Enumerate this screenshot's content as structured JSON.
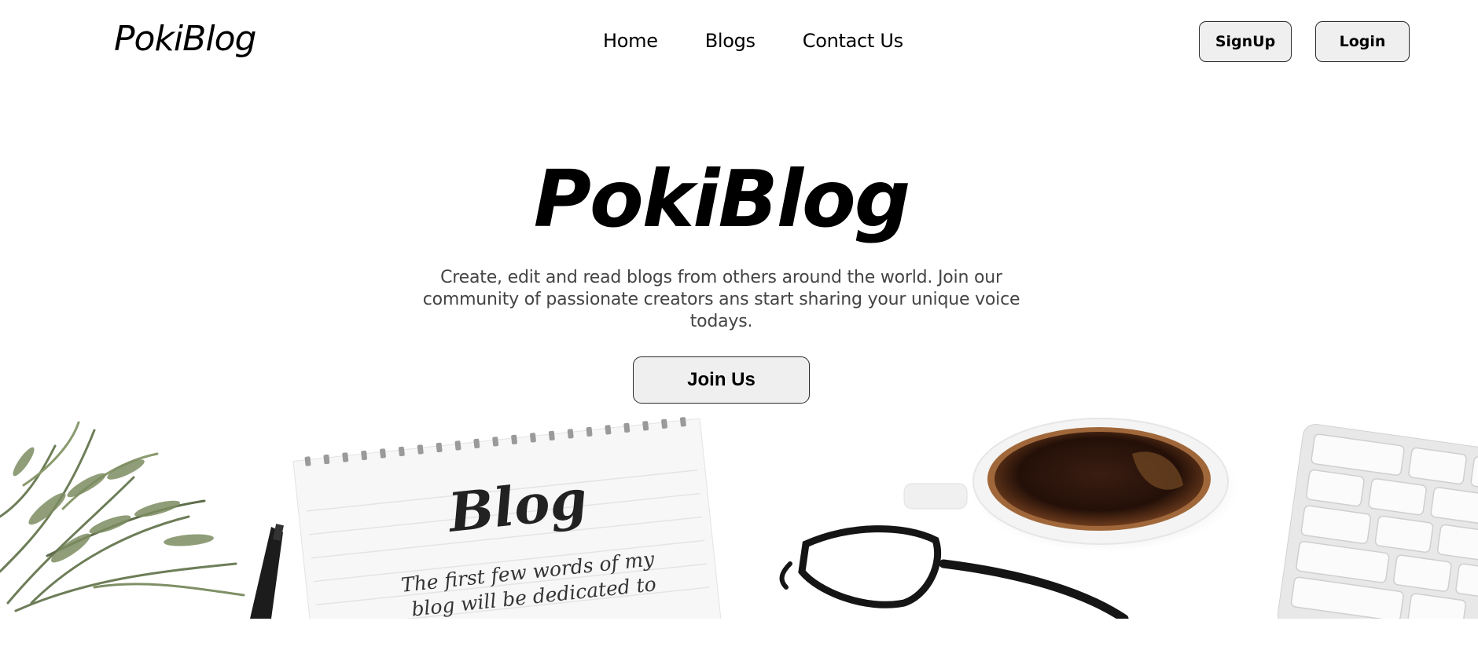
{
  "nav": {
    "brand": "PokiBlog",
    "links": [
      "Home",
      "Blogs",
      "Contact Us"
    ],
    "signup_label": "SignUp",
    "login_label": "Login"
  },
  "hero": {
    "title": "PokiBlog",
    "description": "Create, edit and read blogs from others around the world. Join our community of passionate creators ans start sharing your unique voice todays.",
    "cta_label": "Join Us"
  },
  "banner": {
    "notepad_heading": "Blog",
    "notepad_line1": "The first few words of my",
    "notepad_line2": "blog will be dedicated to"
  },
  "colors": {
    "background": "#ffffff",
    "text": "#000000",
    "muted_text": "#444444",
    "button_bg": "#efefef",
    "button_border": "#2b2b2b"
  }
}
